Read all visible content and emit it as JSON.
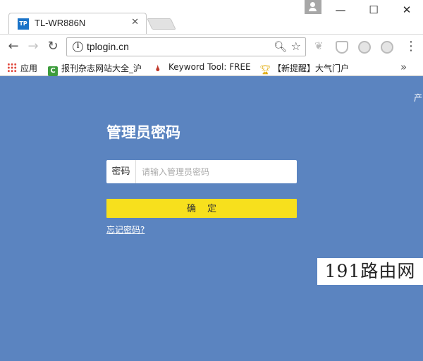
{
  "browser": {
    "tab": {
      "favicon": "TP",
      "title": "TL-WR886N",
      "close": "✕"
    },
    "window_controls": {
      "minimize": "—",
      "maximize": "☐",
      "close": "✕"
    },
    "toolbar": {
      "back": "←",
      "forward": "→",
      "reload": "↻",
      "url": "tplogin.cn",
      "menu": "⋮"
    },
    "bookmarks": [
      {
        "icon": "apps-icon",
        "label": "应用"
      },
      {
        "icon": "c-icon",
        "label": "报刊杂志网站大全_沪"
      },
      {
        "icon": "keyword-tool-icon",
        "label": "Keyword Tool: FREE"
      },
      {
        "icon": "trophy-icon",
        "label": "【新提醒】大气门户"
      }
    ],
    "bookmarks_more": "»"
  },
  "page": {
    "corner_text": "产",
    "title": "管理员密码",
    "password_label": "密码",
    "password_placeholder": "请输入管理员密码",
    "confirm_label": "确定",
    "forgot_link": "忘记密码?",
    "background_color": "#5b84c0",
    "button_color": "#f7e01d"
  },
  "watermark": "191路由网"
}
